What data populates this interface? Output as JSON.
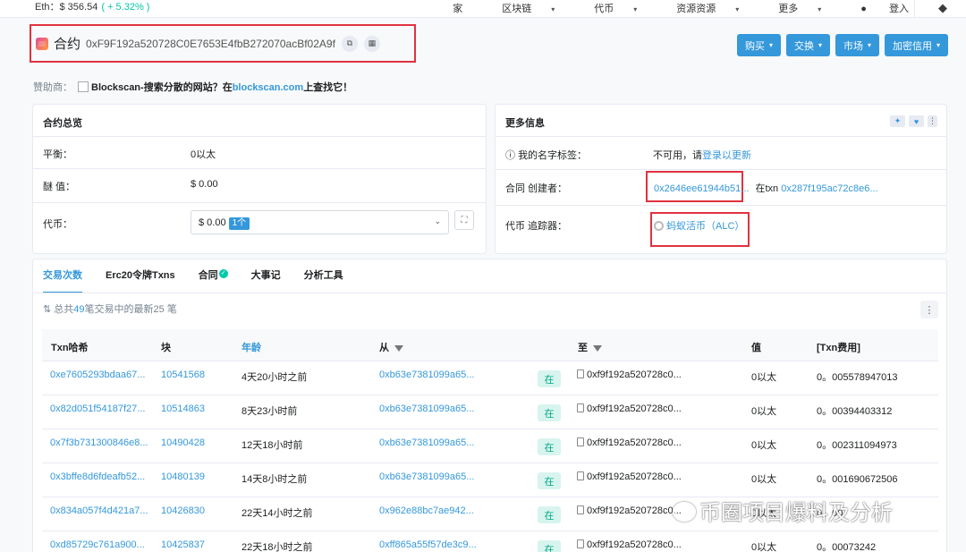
{
  "topbar": {
    "eth_price": "Eth：$ 356.54",
    "eth_change": "( + 5.32% )",
    "nav": [
      "家",
      "区块链",
      "代币",
      "资源资源",
      "更多",
      "登入"
    ]
  },
  "header": {
    "title": "合约",
    "address": "0xF9F192a520728C0E7653E4fbB272070acBf02A9f"
  },
  "actions": [
    "购买",
    "交换",
    "市场",
    "加密信用"
  ],
  "sponsor": {
    "label": "赞助商：",
    "name": "Blockscan",
    "text": "-搜索分散的网站？在",
    "link": "blockscan.com",
    "suffix": "上查找它！"
  },
  "overview": {
    "title": "合约总览",
    "balance_label": "平衡：",
    "balance_value": "0以太",
    "value_label": "醚 值：",
    "value_value": "$ 0.00",
    "token_label": "代币：",
    "token_value": "$ 0.00",
    "token_count": "1个"
  },
  "more_info": {
    "title": "更多信息",
    "tag_label": "我的名字标签：",
    "tag_value": "不可用，请",
    "tag_link": "登录以更新",
    "creator_label": "合同 创建者：",
    "creator_addr": "0x2646ee61944b51...",
    "creator_at": "在txn",
    "creator_txn": "0x287f195ac72c8e6...",
    "tracker_label": "代币 追踪器：",
    "tracker_value": "蚂蚁活币（ALC）"
  },
  "tabs": [
    "交易次数",
    "Erc20令牌Txns",
    "合同",
    "大事记",
    "分析工具"
  ],
  "summary": {
    "prefix": "总共",
    "count": "49",
    "suffix": "笔交易中的最新25 笔"
  },
  "table": {
    "headers": [
      "Txn哈希",
      "块",
      "年龄",
      "从",
      "至",
      "值",
      "[Txn费用]"
    ],
    "direction": "在",
    "rows": [
      {
        "hash": "0xe7605293bdaa67...",
        "block": "10541568",
        "age": "4天20小时之前",
        "from": "0xb63e7381099a65...",
        "to": "0xf9f192a520728c0...",
        "value": "0以太",
        "fee": "0。005578947013"
      },
      {
        "hash": "0x82d051f54187f27...",
        "block": "10514863",
        "age": "8天23小时前",
        "from": "0xb63e7381099a65...",
        "to": "0xf9f192a520728c0...",
        "value": "0以太",
        "fee": "0。00394403312"
      },
      {
        "hash": "0x7f3b731300846e8...",
        "block": "10490428",
        "age": "12天18小时前",
        "from": "0xb63e7381099a65...",
        "to": "0xf9f192a520728c0...",
        "value": "0以太",
        "fee": "0。002311094973"
      },
      {
        "hash": "0x3bffe8d6fdeafb52...",
        "block": "10480139",
        "age": "14天8小时之前",
        "from": "0xb63e7381099a65...",
        "to": "0xf9f192a520728c0...",
        "value": "0以太",
        "fee": "0。001690672506"
      },
      {
        "hash": "0x834a057f4d421a7...",
        "block": "10426830",
        "age": "22天14小时之前",
        "from": "0x962e88bc7ae942...",
        "to": "0xf9f192a520728c0...",
        "value": "0以太",
        "fee": "0。00"
      },
      {
        "hash": "0xd85729c761a900...",
        "block": "10425837",
        "age": "22天18小时之前",
        "from": "0xff865a55f57de3c9...",
        "to": "0xf9f192a520728c0...",
        "value": "0以太",
        "fee": "0。00073242"
      }
    ]
  },
  "watermark": "币圈项目爆料及分析",
  "colors": {
    "accent": "#3498db",
    "highlight_box": "#e0323f",
    "success": "#00c9a7"
  }
}
